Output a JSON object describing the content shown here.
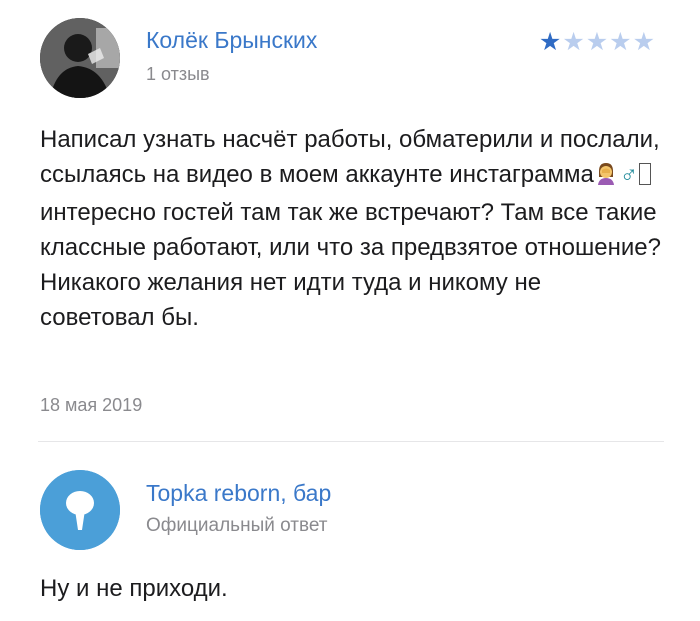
{
  "review": {
    "author_name": "Колёк Брынских",
    "review_count": "1 отзыв",
    "rating": 1,
    "max_rating": 5,
    "text_part1": "Написал узнать насчёт работы, обматерили и послали, ссылаясь на видео в моем аккаунте инстаграмма",
    "emoji_1": "woman-facepalming-icon",
    "male_sign": "♂",
    "text_part2": "интересно гостей там так же встречают? Там все такие классные работают, или что за предвзятое отношение? Никакого желания нет идти туда и никому не советовал бы.",
    "date": "18 мая 2019"
  },
  "reply": {
    "name": "Topka reborn, бар",
    "role": "Официальный ответ",
    "text": "Ну и не приходи."
  },
  "colors": {
    "link": "#3a78c9",
    "star_filled": "#2f6bc4",
    "star_empty": "#b9cdee",
    "muted": "#8a8a8e",
    "reply_avatar": "#4b9fd8"
  }
}
